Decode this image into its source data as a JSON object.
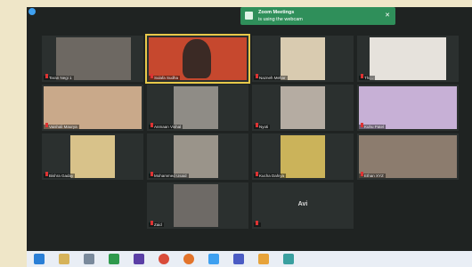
{
  "notification": {
    "title": "Zoom Meetings",
    "message": "is using the webcam",
    "close": "✕"
  },
  "participants": [
    {
      "name": "Taran Negi 1"
    },
    {
      "name": "Sulafa Sudha"
    },
    {
      "name": "Nazneh Mehar"
    },
    {
      "name": "Thi..."
    },
    {
      "name": "Vaishali Maurya"
    },
    {
      "name": "Anmaan Vishal"
    },
    {
      "name": "Nyoti"
    },
    {
      "name": "Kuhu Patel"
    },
    {
      "name": "Bishra Gaday"
    },
    {
      "name": "Mohammed Usaid"
    },
    {
      "name": "Kucha Dahiya"
    },
    {
      "name": "Ethan XYZ"
    },
    {
      "name": "Zaid"
    },
    {
      "name": "",
      "center_label": "Avi"
    }
  ],
  "taskbar": {
    "icons": [
      "windows-start-icon",
      "task-view-icon",
      "file-explorer-icon",
      "store-icon",
      "excel-icon",
      "media-player-icon",
      "chrome-icon",
      "firefox-icon",
      "vlc-icon",
      "zoom-icon",
      "teams-icon",
      "paint-icon",
      "app-icon",
      "xbox-icon"
    ]
  }
}
